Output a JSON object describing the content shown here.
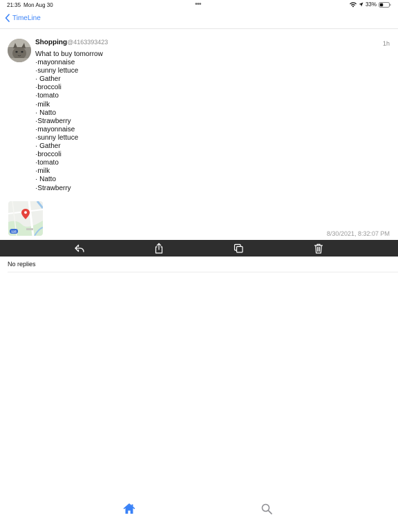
{
  "status": {
    "time": "21:35",
    "date": "Mon Aug 30",
    "dots": "•••",
    "battery": "33%"
  },
  "nav": {
    "back_label": "TimeLine"
  },
  "post": {
    "author": "Shopping",
    "handle": "@4163393423",
    "age": "1h",
    "lines": [
      "What to buy tomorrow",
      "·mayonnaise",
      "·sunny lettuce",
      "· Gather",
      "·broccoli",
      "·tomato",
      "·milk",
      "· Natto",
      "·Strawberry",
      "·mayonnaise",
      "·sunny lettuce",
      "· Gather",
      "·broccoli",
      "·tomato",
      "·milk",
      "· Natto",
      "·Strawberry"
    ],
    "map_route_label": "115",
    "timestamp": "8/30/2021, 8:32:07 PM"
  },
  "replies": {
    "text": "No replies"
  },
  "colors": {
    "accent": "#3a82f7",
    "action_bar": "#2e2e2e"
  },
  "icons": {
    "back": "chevron-left-icon",
    "reply": "reply-icon",
    "share": "share-icon",
    "copy": "copy-icon",
    "delete": "trash-icon",
    "home": "home-icon",
    "search": "search-icon"
  }
}
